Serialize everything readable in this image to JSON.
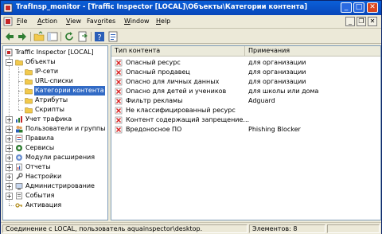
{
  "window": {
    "title": "TrafInsp_monitor - [Traffic Inspector [LOCAL]\\Объекты\\Категории контента]"
  },
  "menu": {
    "items": [
      {
        "pre": "",
        "u": "F",
        "post": "ile"
      },
      {
        "pre": "",
        "u": "A",
        "post": "ction"
      },
      {
        "pre": "",
        "u": "V",
        "post": "iew"
      },
      {
        "pre": "Fav",
        "u": "o",
        "post": "rites"
      },
      {
        "pre": "",
        "u": "W",
        "post": "indow"
      },
      {
        "pre": "",
        "u": "H",
        "post": "elp"
      }
    ]
  },
  "toolbar": {
    "tools": [
      "back-arrow-icon",
      "forward-arrow-icon",
      "up-folder-icon",
      "show-hide-tree-icon",
      "refresh-icon",
      "export-list-icon",
      "help-icon",
      "properties-icon"
    ]
  },
  "tree": {
    "root": "Traffic Inspector [LOCAL]",
    "objects": "Объекты",
    "objects_children": [
      "IP-сети",
      "URL-списки",
      "Категории контента",
      "Атрибуты",
      "Скрипты"
    ],
    "sections": [
      "Учет трафика",
      "Пользователи и группы",
      "Правила",
      "Сервисы",
      "Модули расширения",
      "Отчеты",
      "Настройки",
      "Администрирование",
      "События",
      "Активация"
    ]
  },
  "list": {
    "columns": [
      "Тип контента",
      "Примечания"
    ],
    "rows": [
      {
        "type": "Опасный ресурс",
        "note": "для организации"
      },
      {
        "type": "Опасный продавец",
        "note": "для организации"
      },
      {
        "type": "Опасно для личных данных",
        "note": "для организации"
      },
      {
        "type": "Опасно для детей и учеников",
        "note": "для школы или дома"
      },
      {
        "type": "Фильтр рекламы",
        "note": "Adguard"
      },
      {
        "type": "Не классифицированный ресурс",
        "note": ""
      },
      {
        "type": "Контент содержащий запрещение...",
        "note": ""
      },
      {
        "type": "Вредоносное ПО",
        "note": "Phishing Blocker"
      }
    ]
  },
  "status": {
    "connection": "Соединение с LOCAL, пользователь aquainspector\\desktop.",
    "elements": "Элементов: 8"
  },
  "colors": {
    "title_bar": "#0a5fd8",
    "selection": "#316ac5",
    "item_icon": "#d81e1e"
  }
}
